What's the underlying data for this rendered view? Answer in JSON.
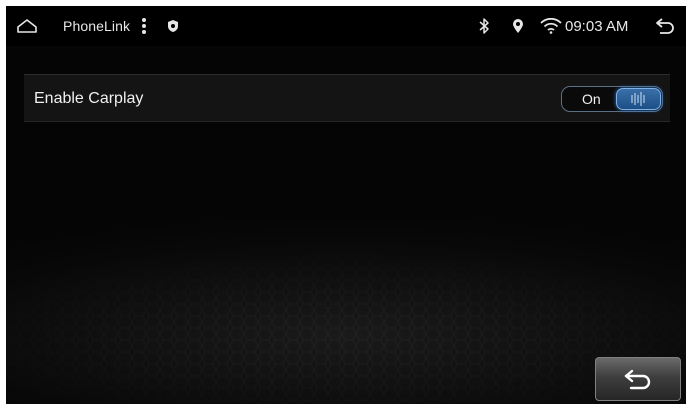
{
  "status_bar": {
    "app_name": "PhoneLink",
    "time": "09:03 AM",
    "icons": [
      "home-icon",
      "more-vert-icon",
      "shield-icon",
      "bluetooth-icon",
      "location-pin-icon",
      "wifi-icon",
      "back-arrow-icon"
    ]
  },
  "setting": {
    "label": "Enable Carplay",
    "toggle_text": "On",
    "toggle_state": "on"
  },
  "footer": {
    "back_button_icon": "back-arrow-icon"
  },
  "colors": {
    "accent": "#2f7ad0",
    "background": "#0a0a0a",
    "text": "#f0f0f0"
  }
}
